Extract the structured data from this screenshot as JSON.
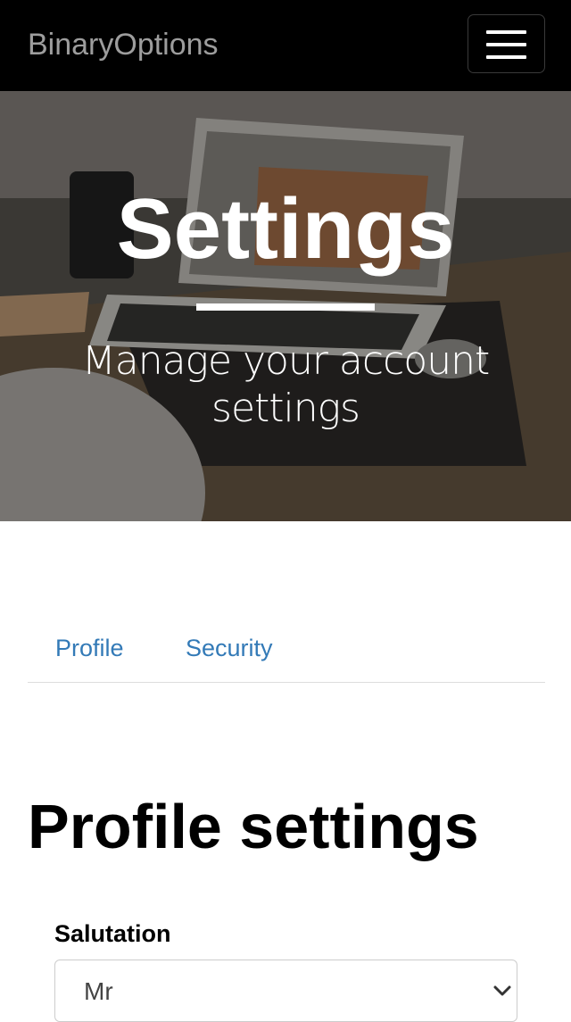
{
  "navbar": {
    "brand": "BinaryOptions",
    "menu_icon": "hamburger-menu-icon"
  },
  "hero": {
    "title": "Settings",
    "subtitle": "Manage your account settings"
  },
  "tabs": [
    {
      "label": "Profile"
    },
    {
      "label": "Security"
    }
  ],
  "profile": {
    "title": "Profile settings",
    "salutation": {
      "label": "Salutation",
      "value": "Mr",
      "icon": "chevron-down-icon"
    }
  },
  "colors": {
    "navbar_bg": "#000000",
    "brand": "#9d9d9d",
    "link": "#337ab7"
  }
}
